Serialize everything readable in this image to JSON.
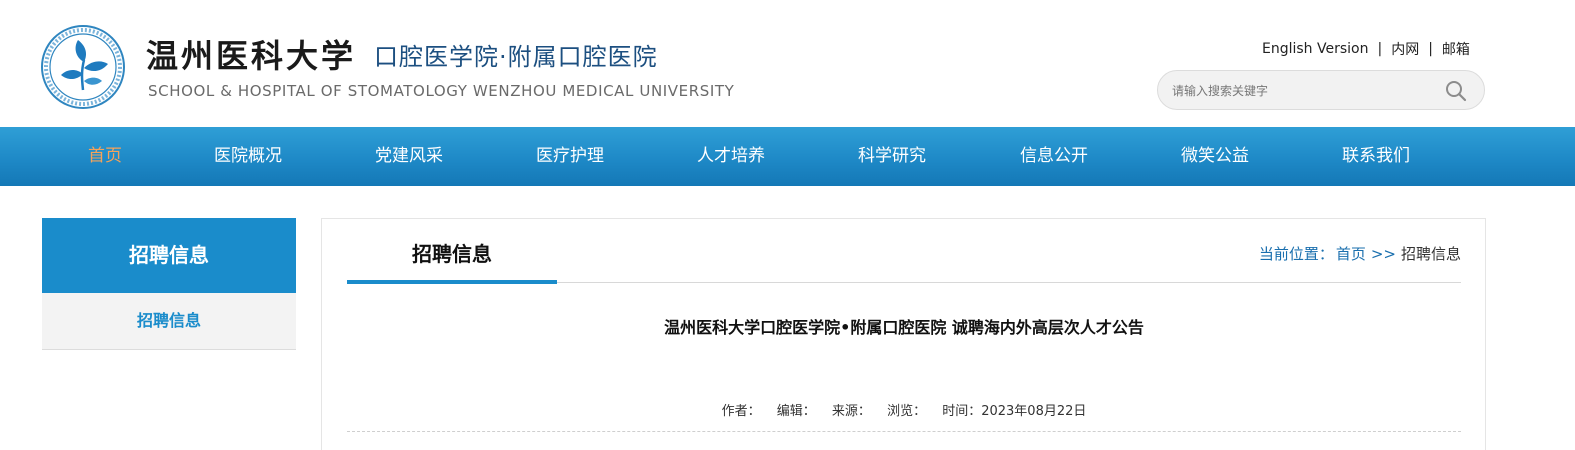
{
  "header": {
    "university_name": "温州医科大学",
    "school_name": "口腔医学院·附属口腔医院",
    "english_name": "SCHOOL & HOSPITAL OF STOMATOLOGY WENZHOU MEDICAL UNIVERSITY",
    "top_links": [
      "English Version",
      "内网",
      "邮箱"
    ],
    "link_separator": "|"
  },
  "search": {
    "placeholder": "请输入搜索关键字",
    "value": ""
  },
  "nav": {
    "items": [
      "首页",
      "医院概况",
      "党建风采",
      "医疗护理",
      "人才培养",
      "科学研究",
      "信息公开",
      "微笑公益",
      "联系我们"
    ],
    "active_index": 0
  },
  "sidebar": {
    "title": "招聘信息",
    "items": [
      "招聘信息"
    ]
  },
  "main": {
    "tab_title": "招聘信息",
    "breadcrumb": {
      "label": "当前位置：",
      "home": "首页",
      "separator": ">>",
      "current": "招聘信息"
    },
    "article": {
      "title": "温州医科大学口腔医学院•附属口腔医院 诚聘海内外高层次人才公告",
      "author_label": "作者：",
      "editor_label": "编辑：",
      "source_label": "来源：",
      "views_label": "浏览：",
      "time_label": "时间：2023年08月22日"
    }
  },
  "colors": {
    "nav_blue": "#1e89c7",
    "active_nav_text": "#f5a35a",
    "sidebar_blue": "#1a8ccb",
    "breadcrumb_blue": "#1a6fae"
  }
}
